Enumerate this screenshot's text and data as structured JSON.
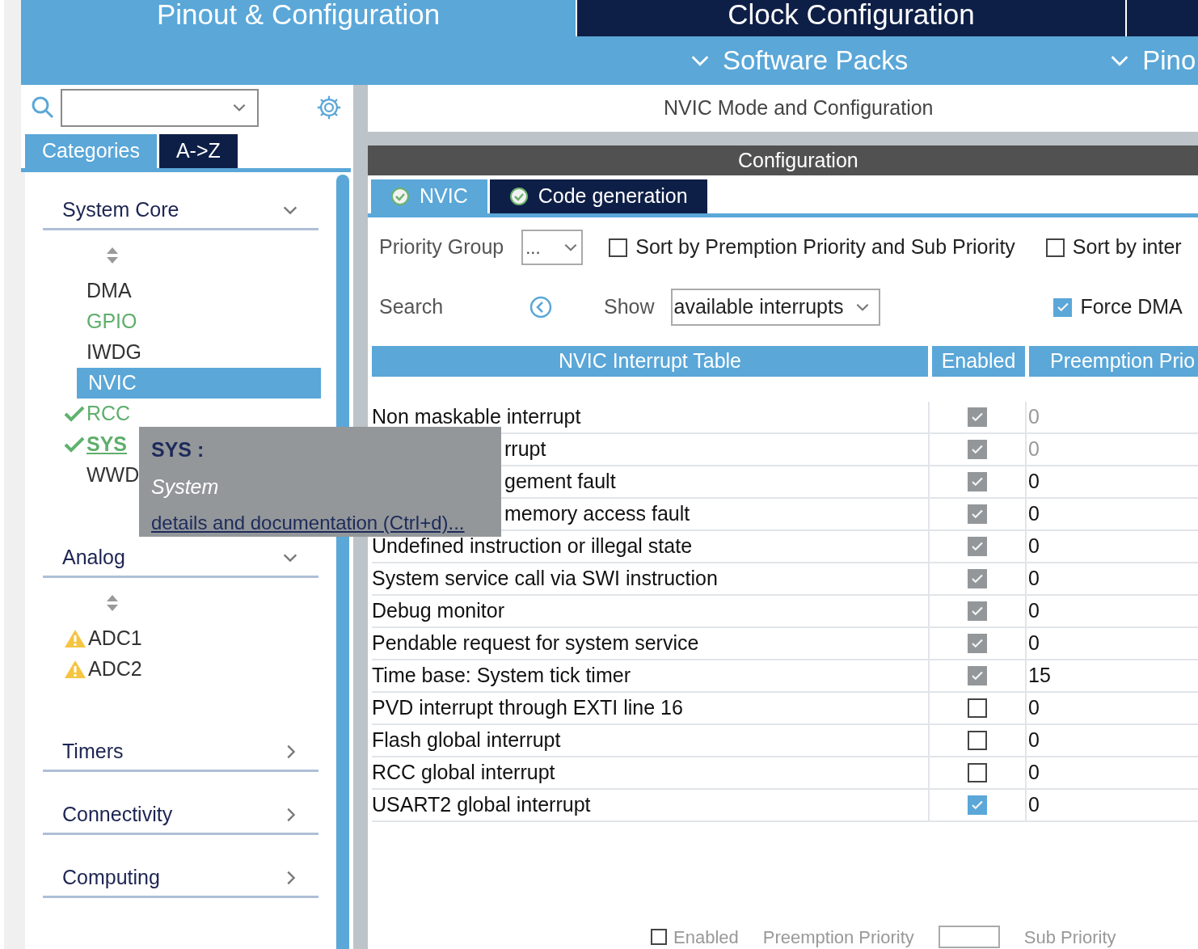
{
  "top_tabs": [
    {
      "label": "Pinout & Configuration",
      "selected": true
    },
    {
      "label": "Clock Configuration",
      "selected": false
    }
  ],
  "sub_menu": [
    "Software Packs",
    "Pino"
  ],
  "sidebar": {
    "tabs": [
      {
        "label": "Categories",
        "selected": true
      },
      {
        "label": "A->Z",
        "selected": false
      }
    ],
    "categories": [
      {
        "label": "System Core",
        "expanded": true,
        "items": [
          {
            "label": "DMA",
            "selected": false,
            "kind": "plain",
            "configured": false,
            "hovered": false
          },
          {
            "label": "GPIO",
            "selected": false,
            "kind": "plain",
            "configured": true,
            "hovered": false
          },
          {
            "label": "IWDG",
            "selected": false,
            "kind": "plain",
            "configured": false,
            "hovered": false
          },
          {
            "label": "NVIC",
            "selected": true,
            "kind": "plain",
            "configured": false,
            "hovered": false
          },
          {
            "label": "RCC",
            "selected": false,
            "kind": "ok",
            "configured": true,
            "hovered": false
          },
          {
            "label": "SYS",
            "selected": false,
            "kind": "ok",
            "configured": true,
            "hovered": true
          },
          {
            "label": "WWD",
            "selected": false,
            "kind": "plain",
            "configured": false,
            "hovered": false
          }
        ]
      },
      {
        "label": "Analog",
        "expanded": true,
        "items": [
          {
            "label": "ADC1",
            "selected": false,
            "kind": "warning",
            "configured": false,
            "hovered": false
          },
          {
            "label": "ADC2",
            "selected": false,
            "kind": "warning",
            "configured": false,
            "hovered": false
          }
        ]
      },
      {
        "label": "Timers",
        "expanded": false
      },
      {
        "label": "Connectivity",
        "expanded": false
      },
      {
        "label": "Computing",
        "expanded": false
      }
    ]
  },
  "tooltip": {
    "title": "SYS :",
    "subtitle": "System",
    "link": "details and documentation (Ctrl+d)..."
  },
  "panel_title": "NVIC Mode and Configuration",
  "config_bar": "Configuration",
  "config_tabs": [
    {
      "label": "NVIC",
      "selected": true
    },
    {
      "label": "Code generation",
      "selected": false
    }
  ],
  "priority_group": {
    "label": "Priority Group",
    "value": "..."
  },
  "sort_options": [
    {
      "label": "Sort by Premption Priority and Sub Priority",
      "checked": false
    },
    {
      "label": "Sort by inter",
      "checked": false
    }
  ],
  "search": {
    "label": "Search"
  },
  "show": {
    "label": "Show",
    "value": "available interrupts"
  },
  "force_dma": {
    "label": "Force DMA",
    "checked": true
  },
  "table": {
    "columns": [
      "NVIC Interrupt Table",
      "Enabled",
      "Preemption Prio"
    ],
    "rows": [
      {
        "name": "Non maskable interrupt",
        "enabled": true,
        "disabled": true,
        "priority": "0",
        "priority_fixed": true
      },
      {
        "name": "rrupt",
        "enabled": true,
        "disabled": true,
        "priority": "0",
        "priority_fixed": true
      },
      {
        "name": "gement fault",
        "enabled": true,
        "disabled": true,
        "priority": "0",
        "priority_fixed": false
      },
      {
        "name": "memory access fault",
        "enabled": true,
        "disabled": true,
        "priority": "0",
        "priority_fixed": false
      },
      {
        "name": "Undefined instruction or illegal state",
        "enabled": true,
        "disabled": true,
        "priority": "0",
        "priority_fixed": false
      },
      {
        "name": "System service call via SWI instruction",
        "enabled": true,
        "disabled": true,
        "priority": "0",
        "priority_fixed": false
      },
      {
        "name": "Debug monitor",
        "enabled": true,
        "disabled": true,
        "priority": "0",
        "priority_fixed": false
      },
      {
        "name": "Pendable request for system service",
        "enabled": true,
        "disabled": true,
        "priority": "0",
        "priority_fixed": false
      },
      {
        "name": "Time base: System tick timer",
        "enabled": true,
        "disabled": true,
        "priority": "15",
        "priority_fixed": false
      },
      {
        "name": "PVD interrupt through EXTI line 16",
        "enabled": false,
        "disabled": false,
        "priority": "0",
        "priority_fixed": false
      },
      {
        "name": "Flash global interrupt",
        "enabled": false,
        "disabled": false,
        "priority": "0",
        "priority_fixed": false
      },
      {
        "name": "RCC global interrupt",
        "enabled": false,
        "disabled": false,
        "priority": "0",
        "priority_fixed": false
      },
      {
        "name": "USART2 global interrupt",
        "enabled": true,
        "disabled": false,
        "priority": "0",
        "priority_fixed": false
      }
    ]
  },
  "bottom": {
    "enabled": {
      "label": "Enabled",
      "checked": false
    },
    "preemption_label": "Preemption Priority",
    "sub_label": "Sub Priority"
  }
}
